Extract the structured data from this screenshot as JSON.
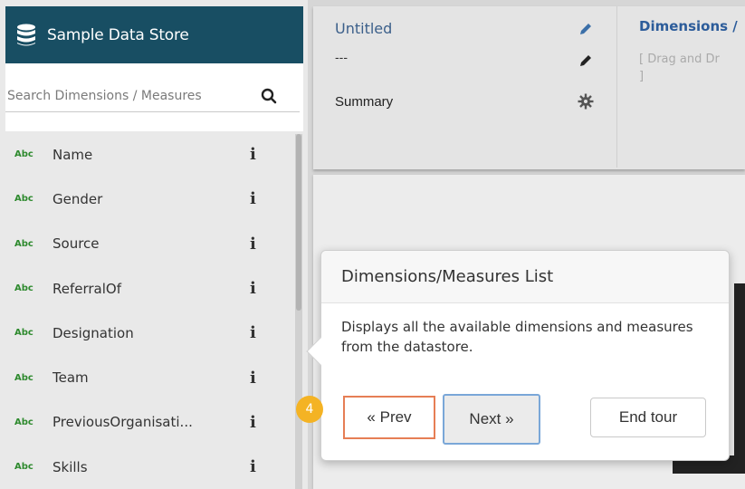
{
  "datastore": {
    "title": "Sample Data Store",
    "icon": "database-icon"
  },
  "search": {
    "placeholder": "Search Dimensions / Measures",
    "icon": "search-icon"
  },
  "items": [
    {
      "type": "Abc",
      "label": "Name"
    },
    {
      "type": "Abc",
      "label": "Gender"
    },
    {
      "type": "Abc",
      "label": "Source"
    },
    {
      "type": "Abc",
      "label": "ReferralOf"
    },
    {
      "type": "Abc",
      "label": "Designation"
    },
    {
      "type": "Abc",
      "label": "Team"
    },
    {
      "type": "Abc",
      "label": "PreviousOrganisati..."
    },
    {
      "type": "Abc",
      "label": "Skills"
    }
  ],
  "info_glyph": "i",
  "panel": {
    "title": "Untitled",
    "subtitle": "---",
    "summary": "Summary",
    "dimensions_title": "Dimensions / ",
    "drag_text": "[ Drag and Dr",
    "drag_text_end": "]"
  },
  "tour": {
    "title": "Dimensions/Measures List",
    "body": "Displays all the available dimensions and measures from the datastore.",
    "prev_label": "« Prev",
    "next_label": "Next »",
    "end_label": "End tour",
    "step": "4"
  },
  "colors": {
    "header_bg": "#184e63",
    "abc_green": "#2e8a2e",
    "badge": "#f4b324",
    "prev_highlight": "#e67e55",
    "next_border": "#7aa7d8"
  }
}
